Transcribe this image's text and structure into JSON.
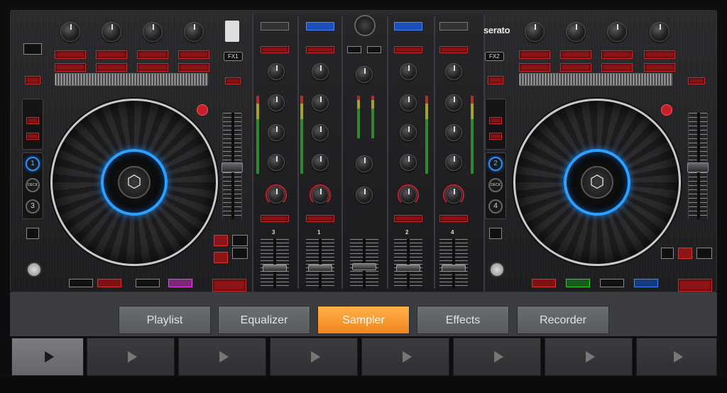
{
  "controller": {
    "brand": "serato",
    "left_deck": {
      "fx_label": "FX1",
      "deck_numbers": [
        "1",
        "DECK",
        "3"
      ],
      "active_deck": "1"
    },
    "right_deck": {
      "fx_label": "FX2",
      "deck_numbers": [
        "2",
        "DECK",
        "4"
      ],
      "active_deck": "2"
    },
    "channels": [
      "3",
      "1",
      "2",
      "4"
    ]
  },
  "tabs": [
    {
      "label": "Playlist",
      "active": false
    },
    {
      "label": "Equalizer",
      "active": false
    },
    {
      "label": "Sampler",
      "active": true
    },
    {
      "label": "Effects",
      "active": false
    },
    {
      "label": "Recorder",
      "active": false
    }
  ],
  "players": {
    "count": 8,
    "active_index": 0
  },
  "colors": {
    "accent_tab": "#f0861c",
    "platter_ring": "#2aa0ff",
    "pad_red": "#8d1417"
  }
}
